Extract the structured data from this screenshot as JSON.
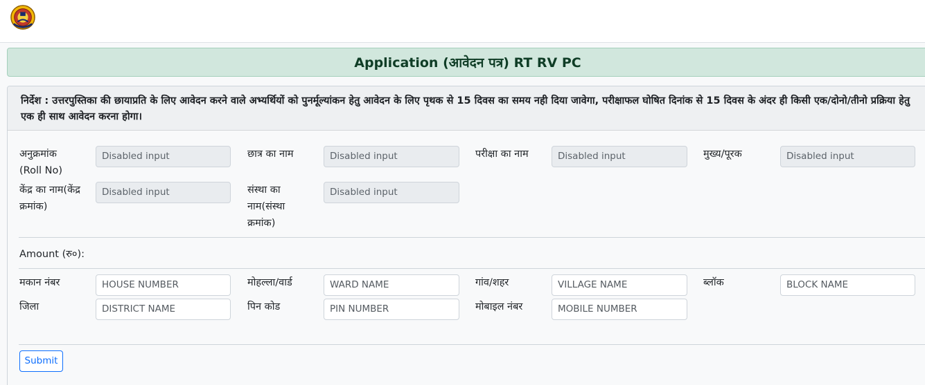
{
  "header": {
    "logo": "university-seal-icon"
  },
  "title": "Application (आवेदन पत्र) RT RV PC",
  "notice": "निर्देश : उत्तरपुस्तिका की छायाप्रति के लिए आवेदन करने वाले अभ्यर्थियों को पुनर्मूल्यांकन हेतु आवेदन के लिए पृथक से 15 दिवस का समय नही दिया जावेगा, परीक्षाफल घोषित दिनांक से 15 दिवस के अंदर ही किसी एक/दोनो/तीनो प्रक्रिया हेतु एक ही साथ आवेदन करना होगा।",
  "student": {
    "roll_label": "अनुक्रमांक (Roll No)",
    "roll_value": "Disabled input",
    "name_label": "छात्र का नाम",
    "name_value": "Disabled input",
    "exam_label": "परीक्षा का नाम",
    "exam_value": "Disabled input",
    "main_label": "मुख्य/पूरक",
    "main_value": "Disabled input",
    "centre_label": "केंद्र का नाम(केंद्र क्रमांक)",
    "centre_value": "Disabled input",
    "institute_label": "संस्था का नाम(संस्था क्रमांक)",
    "institute_value": "Disabled input"
  },
  "amount_label": "Amount (रु०):",
  "address": {
    "house_label": "मकान नंबर",
    "house_placeholder": "HOUSE NUMBER",
    "ward_label": "मोहल्ला/वार्ड",
    "ward_placeholder": "WARD NAME",
    "village_label": "गांव/शहर",
    "village_placeholder": "VILLAGE NAME",
    "block_label": "ब्लॉक",
    "block_placeholder": "BLOCK NAME",
    "district_label": "जिला",
    "district_placeholder": "DISTRICT NAME",
    "pin_label": "पिन कोड",
    "pin_placeholder": "PIN NUMBER",
    "mobile_label": "मोबाइल नंबर",
    "mobile_placeholder": "MOBILE NUMBER"
  },
  "submit_label": "Submit",
  "colors": {
    "title_bg": "#d1e7dd",
    "primary": "#0d6efd",
    "disabled_bg": "#e9ecef"
  }
}
